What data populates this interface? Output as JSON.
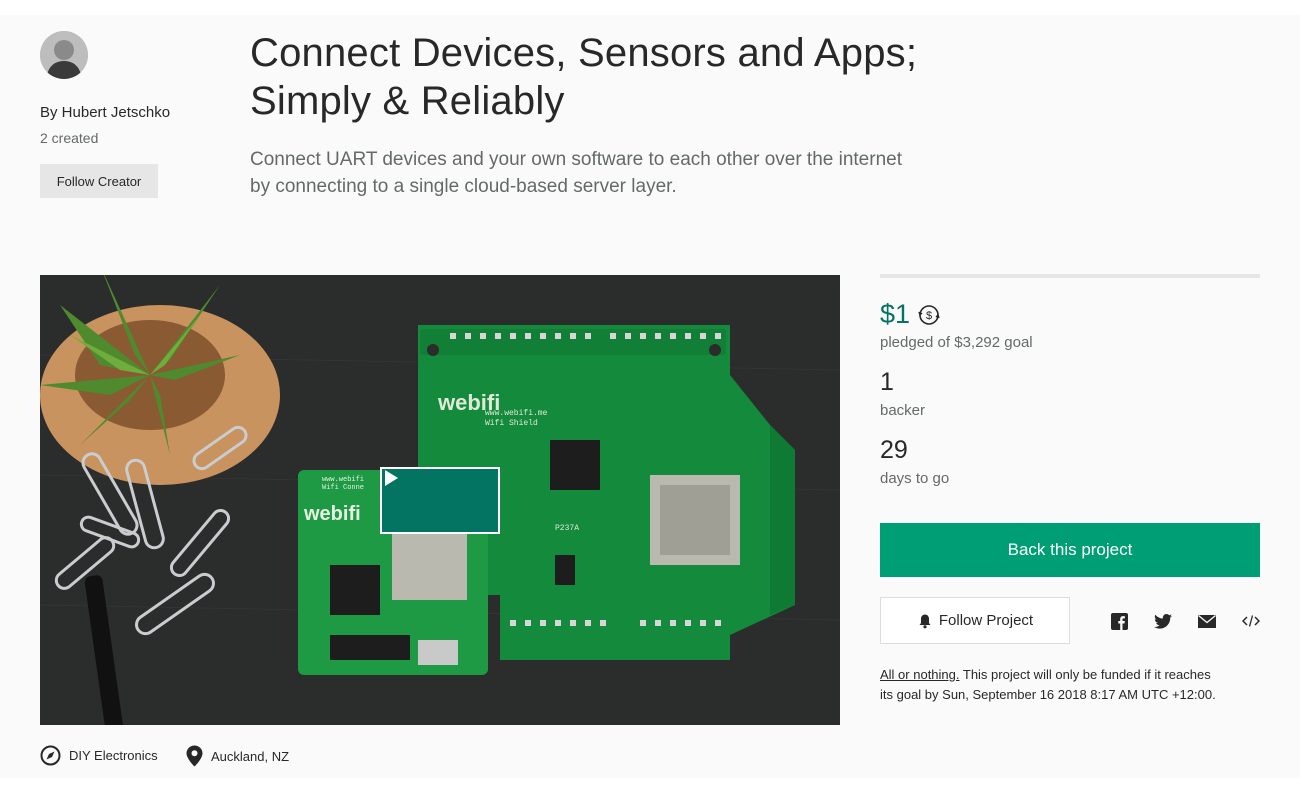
{
  "creator": {
    "by_line": "By Hubert Jetschko",
    "created_count": "2 created",
    "follow_label": "Follow Creator",
    "avatar_icon": "user-avatar"
  },
  "project": {
    "title_line1": "Connect Devices, Sensors and Apps;",
    "title_line2": "Simply & Reliably",
    "blurb_line1": "Connect UART devices and your own software to each other over the internet",
    "blurb_line2": "by connecting to a single cloud-based server layer."
  },
  "video": {
    "board_brand": "webifi",
    "board_url": "www.webifi.me",
    "board_sub": "Wifi Shield",
    "small_board_url": "www.webifi",
    "small_board_sub": "Wifi Conne",
    "board_part": "P237A",
    "play_icon": "play-icon"
  },
  "stats": {
    "pledged": "$1",
    "goal_text": "pledged of $3,292 goal",
    "backers": "1",
    "backers_label": "backer",
    "days": "29",
    "days_label": "days to go",
    "progress_fraction": 0.0003
  },
  "actions": {
    "back_label": "Back this project",
    "follow_label": "Follow Project"
  },
  "share": {
    "icons": [
      "facebook-icon",
      "twitter-icon",
      "email-icon",
      "embed-icon"
    ]
  },
  "funding": {
    "link_text": "All or nothing.",
    "line1_rest": " This project will only be funded if it reaches",
    "line2": "its goal by Sun, September 16 2018 8:17 AM UTC +12:00."
  },
  "tags": {
    "category": "DIY Electronics",
    "location": "Auckland, NZ"
  },
  "colors": {
    "accent": "#037362",
    "back_button": "#009e74",
    "background": "#fafafa"
  }
}
